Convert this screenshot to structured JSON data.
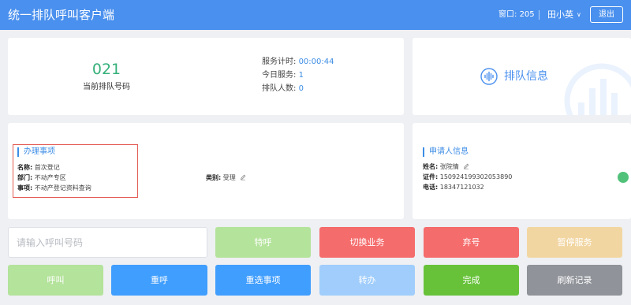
{
  "header": {
    "title": "统一排队呼叫客户端",
    "window_label": "窗口:",
    "window_number": "205",
    "user_name": "田小英",
    "logout_label": "退出"
  },
  "status": {
    "queue_number": "021",
    "queue_number_label": "当前排队号码",
    "service_timer_label": "服务计时:",
    "service_timer_value": "00:00:44",
    "today_service_label": "今日服务:",
    "today_service_value": "1",
    "queue_count_label": "排队人数:",
    "queue_count_value": "0"
  },
  "queue_info": {
    "label": "排队信息"
  },
  "business": {
    "section_title": "办理事项",
    "name_label": "名称:",
    "name_value": "首次登记",
    "dept_label": "部门:",
    "dept_value": "不动产专区",
    "item_label": "事项:",
    "item_value": "不动产登记资料查询",
    "category_label": "类别:",
    "category_value": "受理"
  },
  "applicant": {
    "section_title": "申请人信息",
    "name_label": "姓名:",
    "name_value": "张院情",
    "id_label": "证件:",
    "id_value": "150924199302053890",
    "phone_label": "电话:",
    "phone_value": "18347121032"
  },
  "actions": {
    "input_placeholder": "请输入呼叫号码",
    "special_call": "特呼",
    "switch_business": "切换业务",
    "abandon": "弃号",
    "pause_service": "暂停服务",
    "call": "呼叫",
    "recall": "重呼",
    "reselect": "重选事项",
    "transfer": "转办",
    "complete": "完成",
    "refresh": "刷新记录"
  },
  "colors": {
    "header_bg": "#4a90ee",
    "accent_blue": "#3d8de5",
    "queue_number_green": "#35b07a",
    "highlight_red": "#e25b53",
    "btn_light_green": "#b4e39b",
    "btn_red": "#f56c6c",
    "btn_orange": "#f2d6a2",
    "btn_blue": "#409eff",
    "btn_light_blue": "#a0cdfc",
    "btn_green": "#67c23a",
    "btn_gray": "#909399"
  }
}
